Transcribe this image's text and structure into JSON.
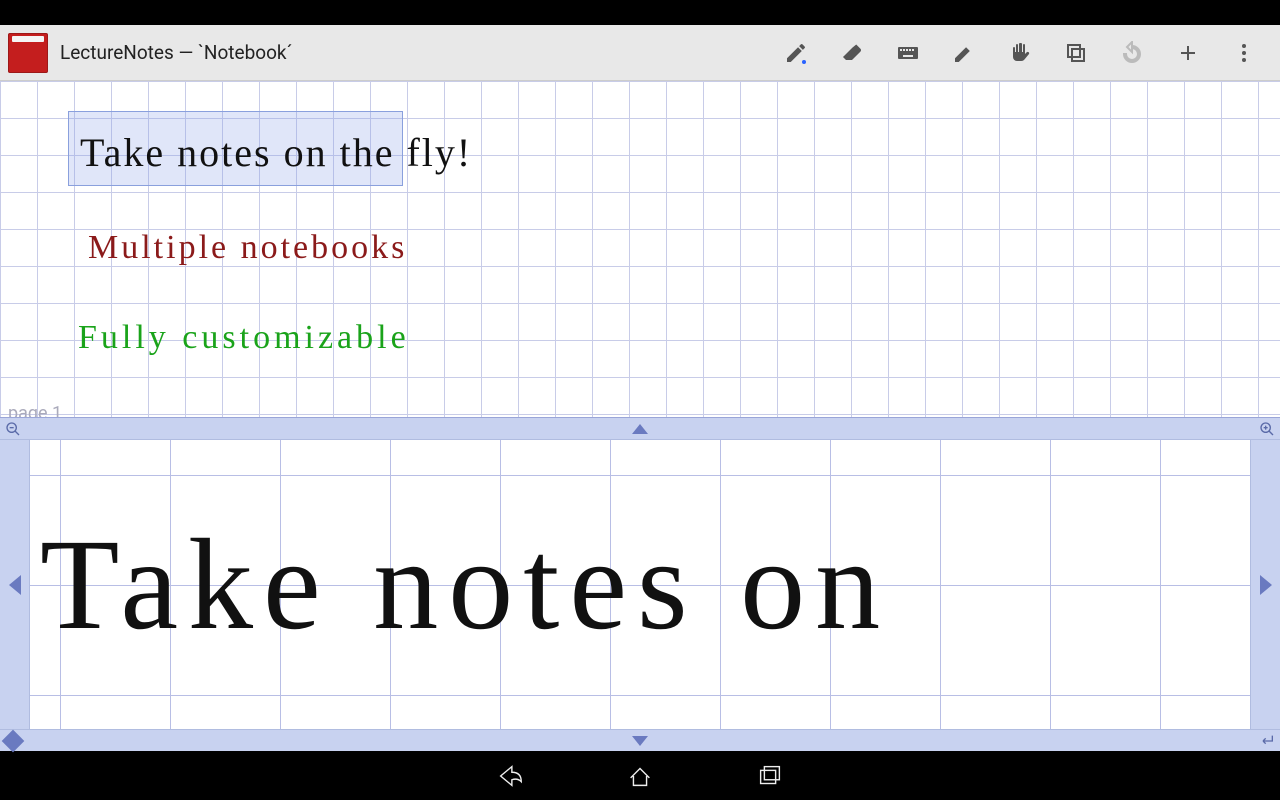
{
  "header": {
    "title": "LectureNotes — `Notebook´"
  },
  "toolbar": {
    "pencil": "pencil",
    "eraser": "eraser",
    "keyboard": "keyboard",
    "pen2": "stylus",
    "hand": "hand",
    "layers": "layers",
    "undo": "undo",
    "add": "add",
    "overflow": "more"
  },
  "canvas": {
    "page_label": "page 1",
    "line1": "Take notes on the fly!",
    "line2": "Multiple notebooks",
    "line3": "Fully customizable"
  },
  "zoom": {
    "text": "Take notes on"
  },
  "colors": {
    "selection": "#8aa0dd",
    "ink_black": "#111111",
    "ink_red": "#8b1a1a",
    "ink_green": "#1aa31a"
  }
}
